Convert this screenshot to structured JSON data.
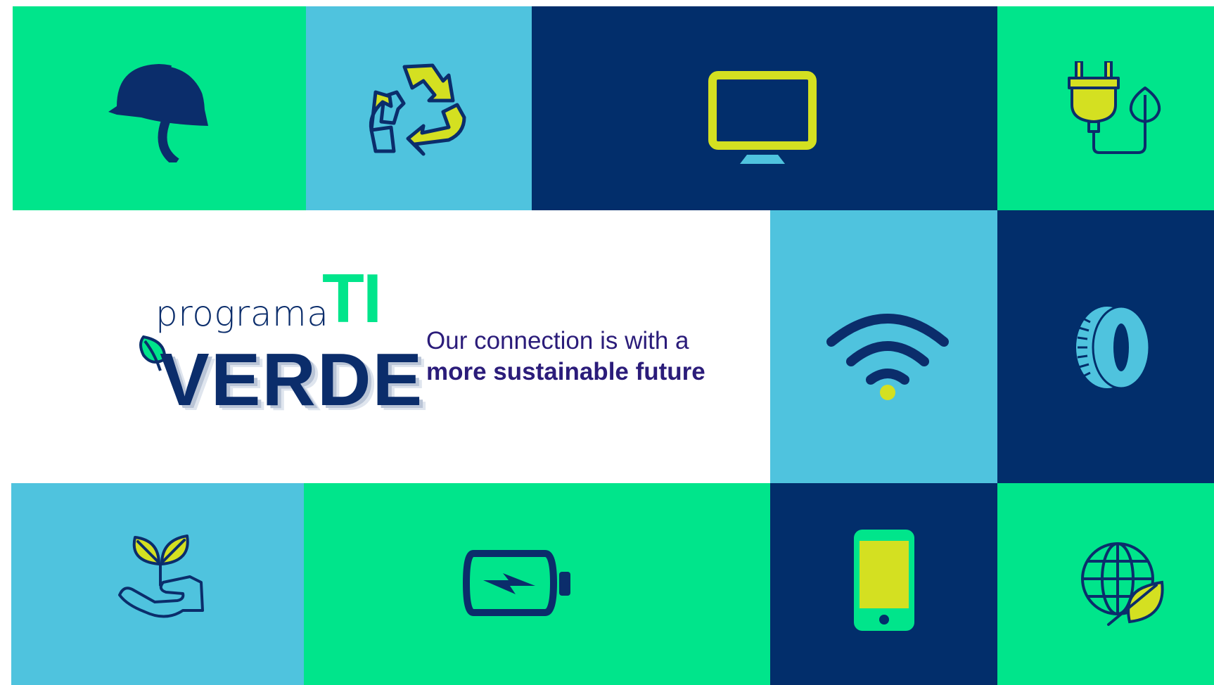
{
  "brand": {
    "logo_word_programa": "programa",
    "logo_word_ti": "TI",
    "logo_word_verde": "VERDE"
  },
  "tagline": {
    "line1": "Our connection is with a",
    "line2": "more sustainable future"
  },
  "colors": {
    "green": "#00e58b",
    "sky": "#4fc3de",
    "navy": "#022e6b",
    "lime": "#d4e021",
    "tagline": "#2b1c7a"
  },
  "icons": [
    "helmet-icon",
    "recycle-icon",
    "monitor-icon",
    "plug-leaf-icon",
    "leaf-icon",
    "wifi-icon",
    "tire-icon",
    "plant-hand-icon",
    "battery-icon",
    "smartphone-icon",
    "globe-leaf-icon"
  ]
}
